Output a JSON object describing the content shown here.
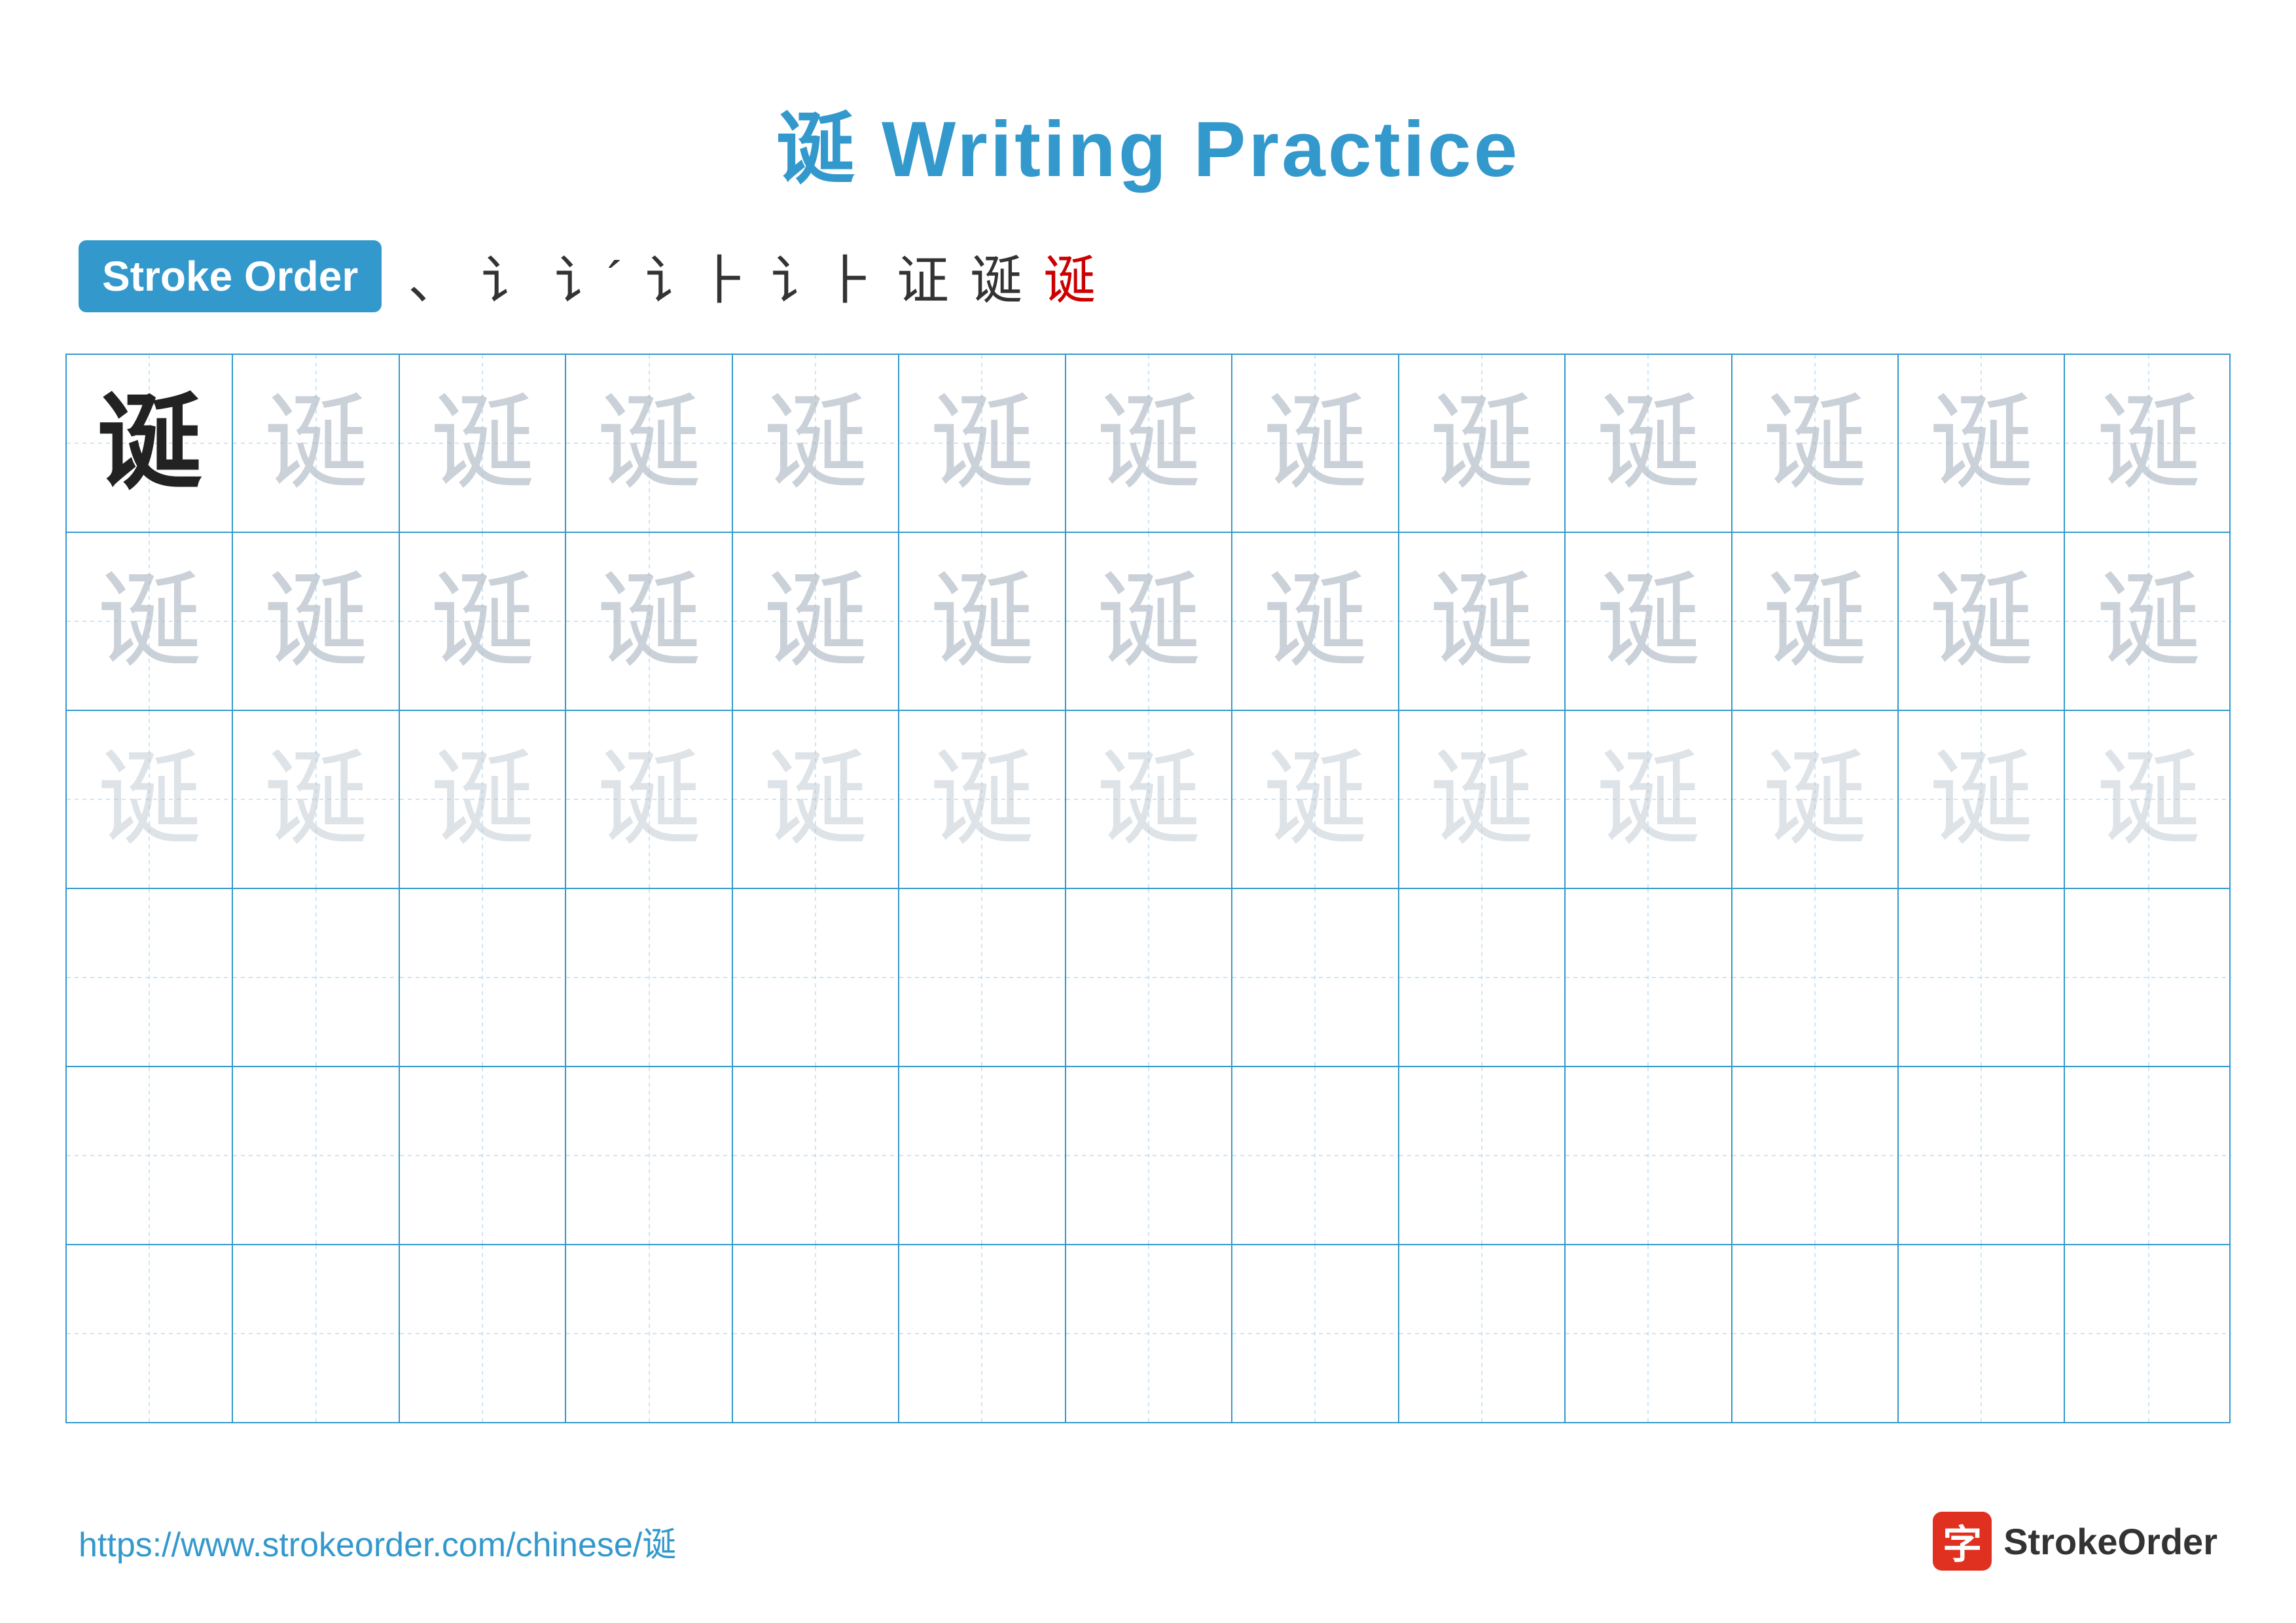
{
  "header": {
    "title": "诞 Writing Practice",
    "title_color": "#3399cc"
  },
  "stroke_order": {
    "badge_label": "Stroke Order",
    "sequence": [
      "、",
      "讠",
      "讠´",
      "讠⺊",
      "讠⺊",
      "证",
      "诞",
      "诞"
    ]
  },
  "grid": {
    "rows": 6,
    "cols": 13,
    "character": "诞",
    "row_styles": [
      "dark",
      "light",
      "lighter",
      "empty",
      "empty",
      "empty"
    ]
  },
  "footer": {
    "url": "https://www.strokeorder.com/chinese/诞",
    "logo_text": "StrokeOrder",
    "logo_icon": "字"
  }
}
